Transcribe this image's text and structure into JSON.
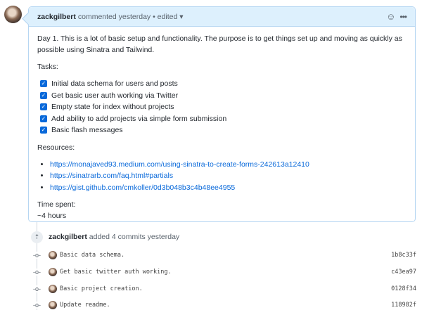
{
  "comment": {
    "author": "zackgilbert",
    "action": "commented yesterday",
    "edited": "• edited",
    "caret": "▾",
    "intro": "Day 1. This is a lot of basic setup and functionality. The purpose is to get things set up and moving as quickly as possible using Sinatra and Tailwind.",
    "tasks_label": "Tasks:",
    "tasks": [
      "Initial data schema for users and posts",
      "Get basic user auth working via Twitter",
      "Empty state for index without projects",
      "Add ability to add projects via simple form submission",
      "Basic flash messages"
    ],
    "resources_label": "Resources:",
    "resources": [
      "https://monajaved93.medium.com/using-sinatra-to-create-forms-242613a12410",
      "https://sinatrarb.com/faq.html#partials",
      "https://gist.github.com/cmkoller/0d3b048b3c4b48ee4955"
    ],
    "time_label": "Time spent:",
    "time": "~4 hours"
  },
  "event": {
    "author": "zackgilbert",
    "text": "added 4 commits yesterday"
  },
  "commits": [
    {
      "message": "Basic data schema.",
      "sha": "1b8c33f"
    },
    {
      "message": "Get basic twitter auth working.",
      "sha": "c43ea97"
    },
    {
      "message": "Basic project creation.",
      "sha": "0128f34"
    },
    {
      "message": "Update readme.",
      "sha": "118982f"
    }
  ]
}
